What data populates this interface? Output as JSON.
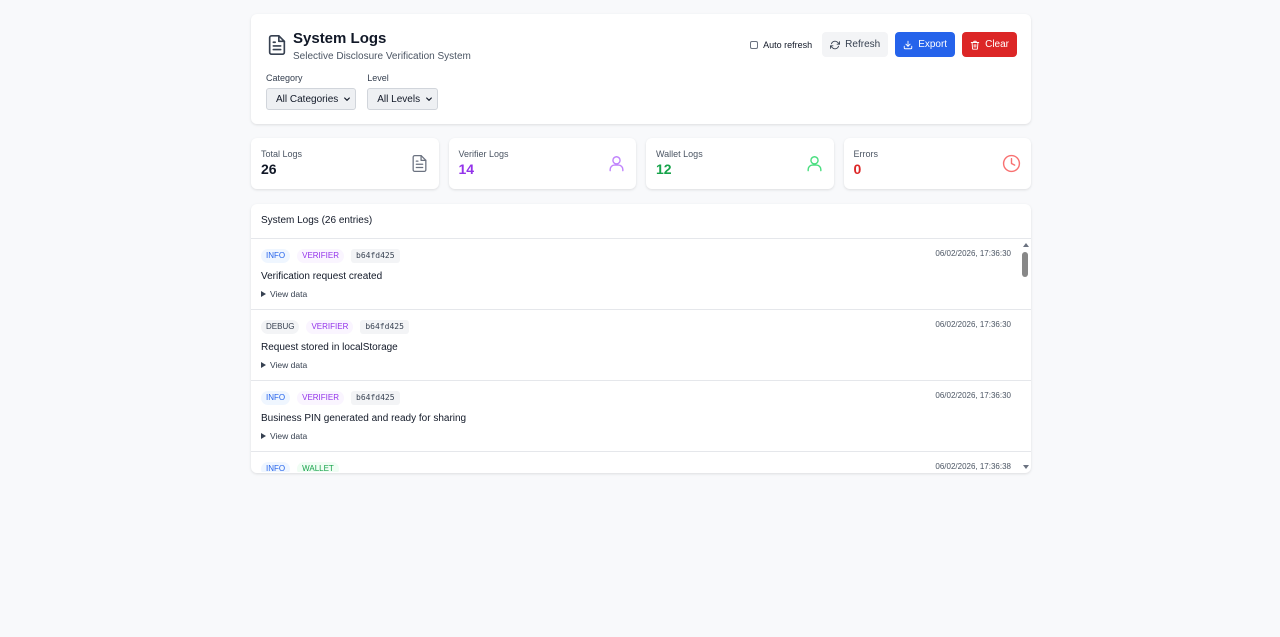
{
  "header": {
    "title": "System Logs",
    "subtitle": "Selective Disclosure Verification System",
    "auto_refresh_label": "Auto refresh",
    "refresh_label": "Refresh",
    "export_label": "Export",
    "clear_label": "Clear"
  },
  "filters": {
    "category_label": "Category",
    "category_value": "All Categories",
    "level_label": "Level",
    "level_value": "All Levels"
  },
  "stats": [
    {
      "label": "Total Logs",
      "value": "26",
      "color": "#111827",
      "icon": "document-icon"
    },
    {
      "label": "Verifier Logs",
      "value": "14",
      "color": "#9333ea",
      "icon": "user-icon"
    },
    {
      "label": "Wallet Logs",
      "value": "12",
      "color": "#16a34a",
      "icon": "user-icon"
    },
    {
      "label": "Errors",
      "value": "0",
      "color": "#dc2626",
      "icon": "clock-icon"
    }
  ],
  "log_list": {
    "heading": "System Logs (26 entries)",
    "entries": [
      {
        "level": "INFO",
        "category": "VERIFIER",
        "session": "b64fd425",
        "timestamp": "06/02/2026, 17:36:30",
        "message": "Verification request created",
        "view_data": "View data"
      },
      {
        "level": "DEBUG",
        "category": "VERIFIER",
        "session": "b64fd425",
        "timestamp": "06/02/2026, 17:36:30",
        "message": "Request stored in localStorage",
        "view_data": "View data"
      },
      {
        "level": "INFO",
        "category": "VERIFIER",
        "session": "b64fd425",
        "timestamp": "06/02/2026, 17:36:30",
        "message": "Business PIN generated and ready for sharing",
        "view_data": "View data"
      },
      {
        "level": "INFO",
        "category": "WALLET",
        "session": "",
        "timestamp": "06/02/2026, 17:36:38",
        "message": "",
        "view_data": ""
      }
    ]
  },
  "colors": {
    "primary": "#2563eb",
    "danger": "#dc2626",
    "verifier": "#9333ea",
    "wallet": "#16a34a"
  }
}
